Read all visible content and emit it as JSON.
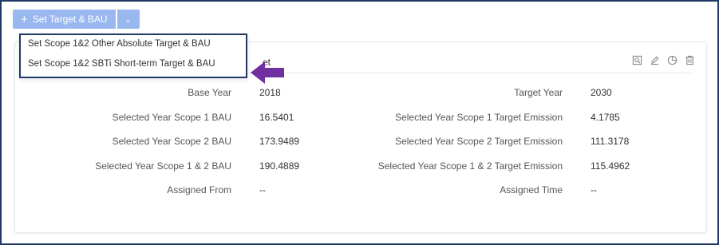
{
  "toolbar": {
    "set_target_label": "Set Target & BAU",
    "plus_glyph": "+",
    "caret_glyph": "⌄"
  },
  "dropdown": {
    "items": [
      "Set Scope 1&2 Other Absolute Target & BAU",
      "Set Scope 1&2 SBTi Short-term Target & BAU"
    ]
  },
  "card": {
    "title_fragment": "et",
    "icons": [
      "preview-icon",
      "edit-icon",
      "history-icon",
      "delete-icon"
    ],
    "rows": [
      {
        "label1": "Base Year",
        "value1": "2018",
        "label2": "Target Year",
        "value2": "2030"
      },
      {
        "label1": "Selected Year Scope 1 BAU",
        "value1": "16.5401",
        "label2": "Selected Year Scope 1 Target Emission",
        "value2": "4.1785"
      },
      {
        "label1": "Selected Year Scope 2 BAU",
        "value1": "173.9489",
        "label2": "Selected Year Scope 2 Target Emission",
        "value2": "111.3178"
      },
      {
        "label1": "Selected Year Scope 1 & 2 BAU",
        "value1": "190.4889",
        "label2": "Selected Year Scope 1 & 2 Target Emission",
        "value2": "115.4962"
      },
      {
        "label1": "Assigned From",
        "value1": "--",
        "label2": "Assigned Time",
        "value2": "--"
      }
    ]
  },
  "colors": {
    "button": "#9ab8f0",
    "frame": "#1f3864",
    "arrow": "#7030a0"
  }
}
